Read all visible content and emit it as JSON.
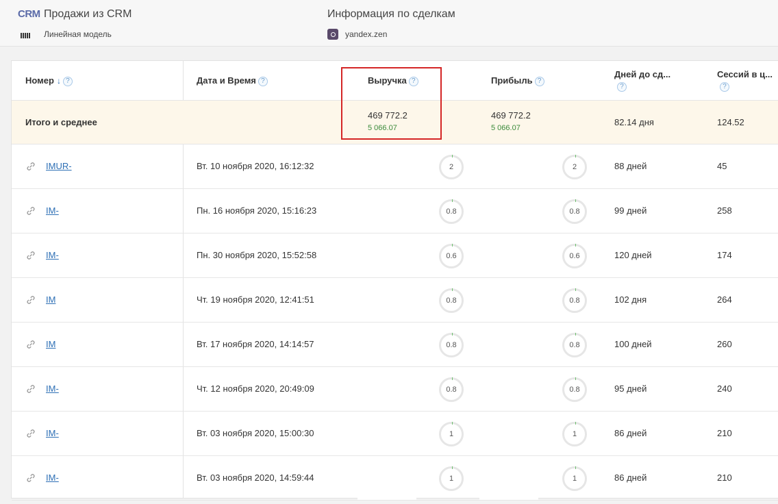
{
  "header": {
    "logo": "CRM",
    "title": "Продажи из CRM",
    "model": "Линейная модель",
    "info_title": "Информация по сделкам",
    "source": "yandex.zen"
  },
  "table": {
    "columns": {
      "number": "Номер",
      "datetime": "Дата и Время",
      "revenue": "Выручка",
      "profit": "Прибыль",
      "days": "Дней до сд...",
      "sessions": "Сессий в ц..."
    },
    "help_glyph": "?",
    "sort_arrow": "↓",
    "totals": {
      "label": "Итого и среднее",
      "revenue": "469 772.2",
      "revenue_avg": "5 066.07",
      "profit": "469 772.2",
      "profit_avg": "5 066.07",
      "days": "82.14 дня",
      "sessions": "124.52"
    },
    "rows": [
      {
        "order": "IMUR-",
        "datetime": "Вт. 10 ноября 2020, 16:12:32",
        "revenue": "2",
        "profit": "2",
        "days": "88 дней",
        "sessions": "45"
      },
      {
        "order": "IM-",
        "datetime": "Пн. 16 ноября 2020, 15:16:23",
        "revenue": "0.8",
        "profit": "0.8",
        "days": "99 дней",
        "sessions": "258"
      },
      {
        "order": "IM-",
        "datetime": "Пн. 30 ноября 2020, 15:52:58",
        "revenue": "0.6",
        "profit": "0.6",
        "days": "120 дней",
        "sessions": "174"
      },
      {
        "order": "IM",
        "datetime": "Чт. 19 ноября 2020, 12:41:51",
        "revenue": "0.8",
        "profit": "0.8",
        "days": "102 дня",
        "sessions": "264"
      },
      {
        "order": "IM",
        "datetime": "Вт. 17 ноября 2020, 14:14:57",
        "revenue": "0.8",
        "profit": "0.8",
        "days": "100 дней",
        "sessions": "260"
      },
      {
        "order": "IM-",
        "datetime": "Чт. 12 ноября 2020, 20:49:09",
        "revenue": "0.8",
        "profit": "0.8",
        "days": "95 дней",
        "sessions": "240"
      },
      {
        "order": "IM-",
        "datetime": "Вт. 03 ноября 2020, 15:00:30",
        "revenue": "1",
        "profit": "1",
        "days": "86 дней",
        "sessions": "210"
      },
      {
        "order": "IM-",
        "datetime": "Вт. 03 ноября 2020, 14:59:44",
        "revenue": "1",
        "profit": "1",
        "days": "86 дней",
        "sessions": "210"
      }
    ]
  },
  "colors": {
    "accent": "#2d6fb5",
    "highlight_border": "#d42525",
    "totals_bg": "#fdf7ea",
    "green": "#3a8a3a"
  }
}
